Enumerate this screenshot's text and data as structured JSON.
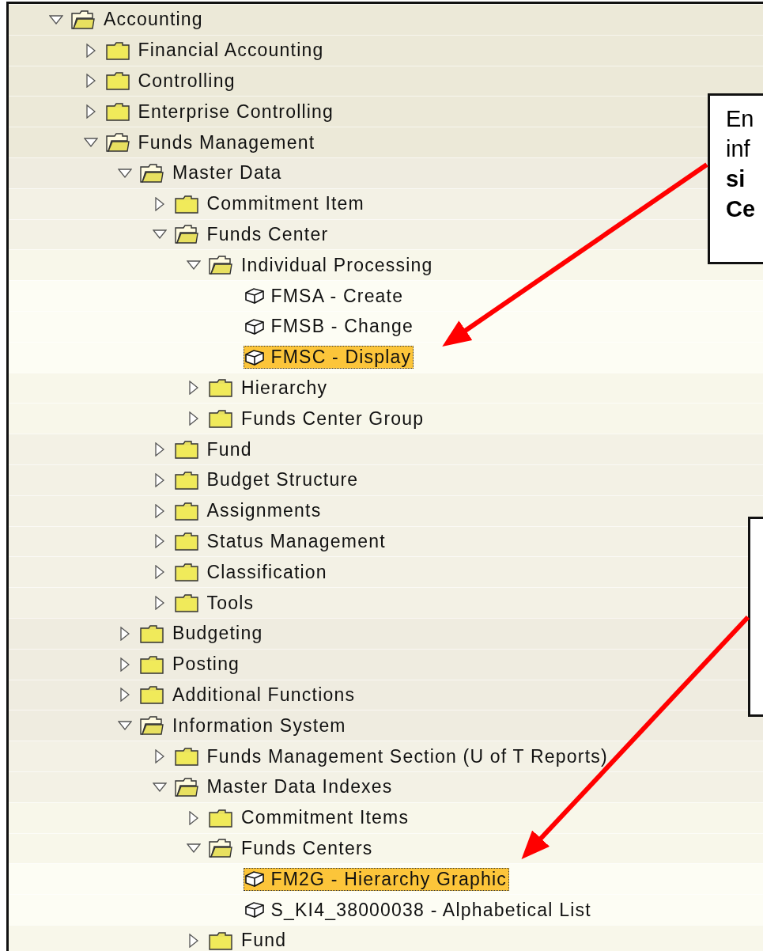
{
  "tree": [
    {
      "label": "Accounting",
      "kind": "folder",
      "expanded": true,
      "children": [
        {
          "label": "Financial Accounting",
          "kind": "folder",
          "expanded": false
        },
        {
          "label": "Controlling",
          "kind": "folder",
          "expanded": false
        },
        {
          "label": "Enterprise Controlling",
          "kind": "folder",
          "expanded": false
        },
        {
          "label": "Funds Management",
          "kind": "folder",
          "expanded": true,
          "children": [
            {
              "label": "Master Data",
              "kind": "folder",
              "expanded": true,
              "children": [
                {
                  "label": "Commitment Item",
                  "kind": "folder",
                  "expanded": false
                },
                {
                  "label": "Funds Center",
                  "kind": "folder",
                  "expanded": true,
                  "children": [
                    {
                      "label": "Individual Processing",
                      "kind": "folder",
                      "expanded": true,
                      "children": [
                        {
                          "label": "FMSA - Create",
                          "kind": "transaction",
                          "selected": false
                        },
                        {
                          "label": "FMSB - Change",
                          "kind": "transaction",
                          "selected": false
                        },
                        {
                          "label": "FMSC - Display",
                          "kind": "transaction",
                          "selected": true
                        }
                      ]
                    },
                    {
                      "label": "Hierarchy",
                      "kind": "folder",
                      "expanded": false
                    },
                    {
                      "label": "Funds Center Group",
                      "kind": "folder",
                      "expanded": false
                    }
                  ]
                },
                {
                  "label": "Fund",
                  "kind": "folder",
                  "expanded": false
                },
                {
                  "label": "Budget Structure",
                  "kind": "folder",
                  "expanded": false
                },
                {
                  "label": "Assignments",
                  "kind": "folder",
                  "expanded": false
                },
                {
                  "label": "Status Management",
                  "kind": "folder",
                  "expanded": false
                },
                {
                  "label": "Classification",
                  "kind": "folder",
                  "expanded": false
                },
                {
                  "label": "Tools",
                  "kind": "folder",
                  "expanded": false
                }
              ]
            },
            {
              "label": "Budgeting",
              "kind": "folder",
              "expanded": false
            },
            {
              "label": "Posting",
              "kind": "folder",
              "expanded": false
            },
            {
              "label": "Additional Functions",
              "kind": "folder",
              "expanded": false
            },
            {
              "label": "Information System",
              "kind": "folder",
              "expanded": true,
              "children": [
                {
                  "label": "Funds Management Section (U of T Reports)",
                  "kind": "folder",
                  "expanded": false
                },
                {
                  "label": "Master Data Indexes",
                  "kind": "folder",
                  "expanded": true,
                  "children": [
                    {
                      "label": "Commitment Items",
                      "kind": "folder",
                      "expanded": false
                    },
                    {
                      "label": "Funds Centers",
                      "kind": "folder",
                      "expanded": true,
                      "children": [
                        {
                          "label": "FM2G - Hierarchy Graphic",
                          "kind": "transaction",
                          "selected": true
                        },
                        {
                          "label": "S_KI4_38000038 - Alphabetical List",
                          "kind": "transaction",
                          "selected": false
                        }
                      ]
                    },
                    {
                      "label": "Fund",
                      "kind": "folder",
                      "expanded": false
                    }
                  ]
                }
              ]
            }
          ]
        }
      ]
    }
  ],
  "callouts": [
    {
      "kind": "note",
      "lines": [
        {
          "text": "En",
          "bold": false
        },
        {
          "text": "inf",
          "bold": false
        },
        {
          "text": "si",
          "bold": true
        },
        {
          "text": "Ce",
          "bold": true
        }
      ]
    },
    {
      "kind": "note"
    }
  ]
}
